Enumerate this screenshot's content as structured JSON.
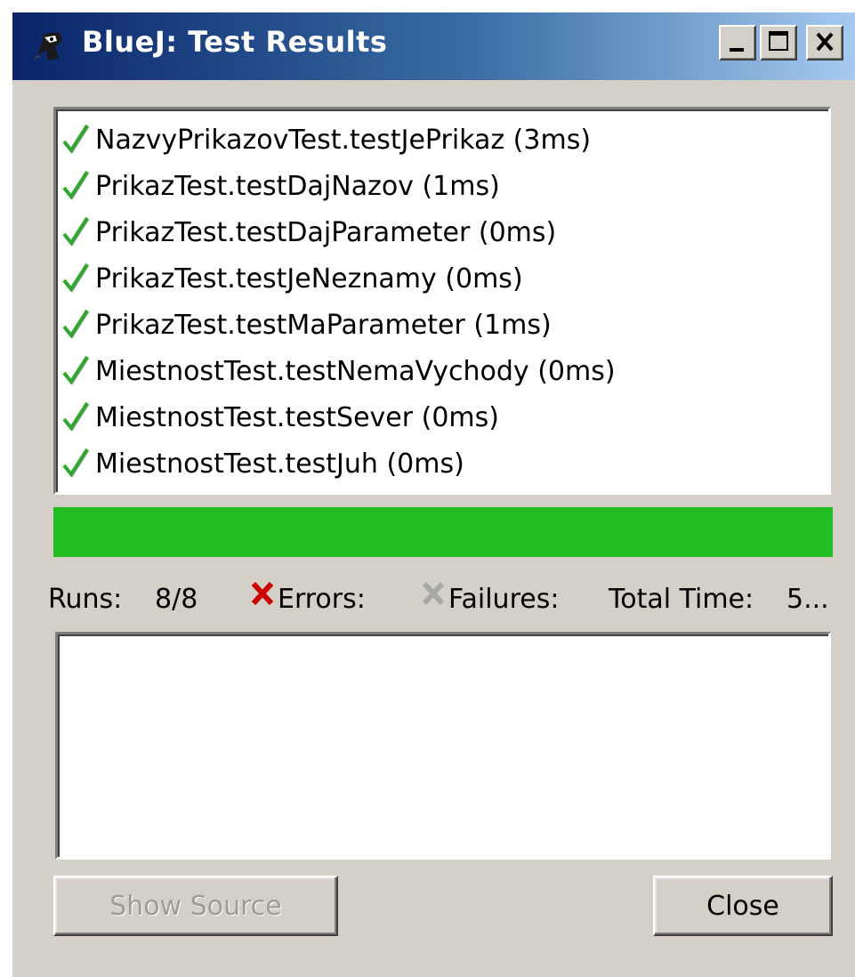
{
  "window": {
    "title": "BlueJ:  Test Results",
    "controls": {
      "minimize": "minimize-icon",
      "maximize": "maximize-icon",
      "close": "close-icon"
    }
  },
  "results": [
    {
      "label": "NazvyPrikazovTest.testJePrikaz (3ms)",
      "status": "passed",
      "icon": "check-icon"
    },
    {
      "label": "PrikazTest.testDajNazov (1ms)",
      "status": "passed",
      "icon": "check-icon"
    },
    {
      "label": "PrikazTest.testDajParameter (0ms)",
      "status": "passed",
      "icon": "check-icon"
    },
    {
      "label": "PrikazTest.testJeNeznamy (0ms)",
      "status": "passed",
      "icon": "check-icon"
    },
    {
      "label": "PrikazTest.testMaParameter (1ms)",
      "status": "passed",
      "icon": "check-icon"
    },
    {
      "label": "MiestnostTest.testNemaVychody (0ms)",
      "status": "passed",
      "icon": "check-icon"
    },
    {
      "label": "MiestnostTest.testSever (0ms)",
      "status": "passed",
      "icon": "check-icon"
    },
    {
      "label": "MiestnostTest.testJuh (0ms)",
      "status": "passed",
      "icon": "check-icon"
    }
  ],
  "progress": {
    "fraction": 1.0,
    "color": "#22bd22"
  },
  "stats": {
    "runs_label": "Runs:",
    "runs_value": "8/8",
    "errors_label": "Errors:",
    "failures_label": "Failures:",
    "total_time_label": "Total Time:",
    "total_time_value": "5..."
  },
  "buttons": {
    "show_source": "Show Source",
    "close": "Close"
  },
  "colors": {
    "titlebar_start": "#0a246a",
    "titlebar_end": "#a6caf0",
    "window_bg": "#d4d0c8",
    "error_icon": "#cc0000",
    "failure_icon": "#a8a8a8"
  }
}
